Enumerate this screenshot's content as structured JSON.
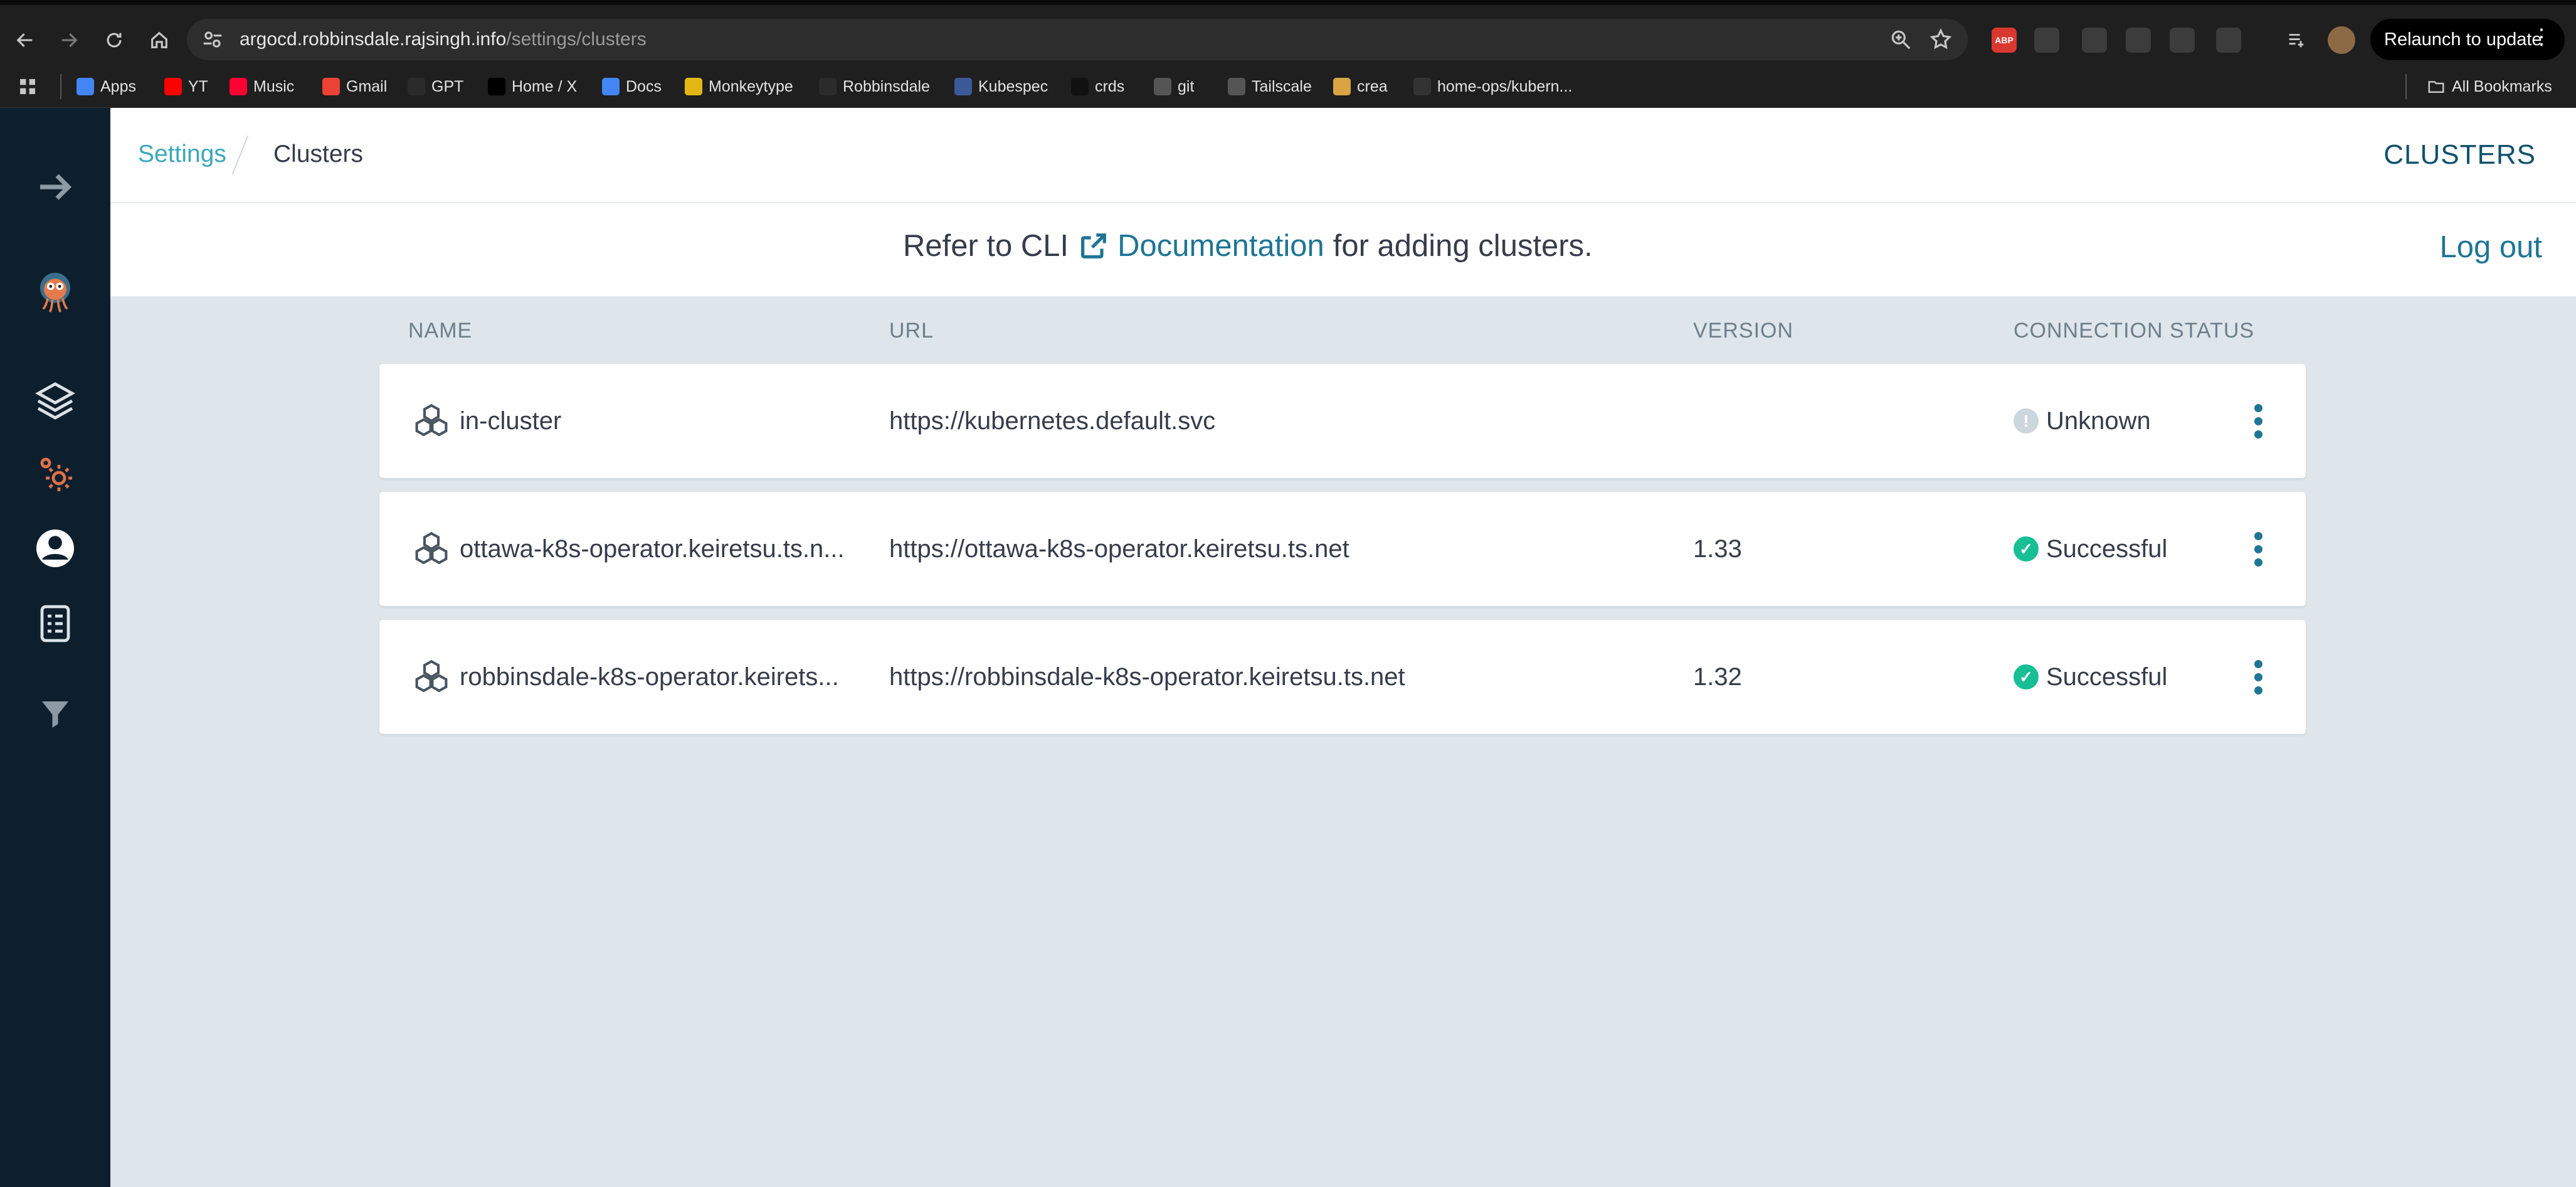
{
  "browser": {
    "url_host": "argocd.robbinsdale.rajsingh.info",
    "url_path": "/settings/clusters",
    "relaunch_label": "Relaunch to update",
    "extensions": [
      {
        "icon": "adblock-icon",
        "text": "ABP",
        "color": "#d9382f"
      },
      {
        "icon": "translate-extension-icon",
        "text": "",
        "color": "#3c3c3c"
      },
      {
        "icon": "screenshot-extension-icon",
        "text": "",
        "color": "#3c3c3c"
      },
      {
        "icon": "grammar-extension-icon",
        "text": "",
        "color": "#3c3c3c"
      },
      {
        "icon": "pen-extension-icon",
        "text": "",
        "color": "#3c3c3c"
      },
      {
        "icon": "puzzle-icon",
        "text": "",
        "color": "#3c3c3c"
      }
    ],
    "bookmarks": [
      {
        "label": "Apps",
        "icon": "apps-grid-icon"
      },
      {
        "label": "YT",
        "icon": "youtube-icon"
      },
      {
        "label": "Music",
        "icon": "youtube-music-icon"
      },
      {
        "label": "Gmail",
        "icon": "gmail-icon"
      },
      {
        "label": "GPT",
        "icon": "openai-icon"
      },
      {
        "label": "Home / X",
        "icon": "x-icon"
      },
      {
        "label": "Docs",
        "icon": "docs-icon"
      },
      {
        "label": "Monkeytype",
        "icon": "monkeytype-icon"
      },
      {
        "label": "Robbinsdale",
        "icon": "globe-icon"
      },
      {
        "label": "Kubespec",
        "icon": "kubespec-icon"
      },
      {
        "label": "crds",
        "icon": "crds-icon"
      },
      {
        "label": "git",
        "icon": "folder-icon"
      },
      {
        "label": "Tailscale",
        "icon": "tailscale-icon"
      },
      {
        "label": "crea",
        "icon": "box-icon"
      },
      {
        "label": "home-ops/kubern...",
        "icon": "github-icon"
      }
    ],
    "all_bookmarks_label": "All Bookmarks"
  },
  "header": {
    "breadcrumb_root": "Settings",
    "breadcrumb_current": "Clusters",
    "title": "CLUSTERS"
  },
  "toolbar": {
    "notice_prefix": "Refer to CLI",
    "doc_link": "Documentation",
    "notice_suffix": "for adding clusters.",
    "logout": "Log out"
  },
  "table": {
    "columns": [
      "NAME",
      "URL",
      "VERSION",
      "CONNECTION STATUS"
    ],
    "rows": [
      {
        "name": "in-cluster",
        "url": "https://kubernetes.default.svc",
        "version": "",
        "status": "Unknown",
        "status_color": "#ccd6dd"
      },
      {
        "name": "ottawa-k8s-operator.keiretsu.ts.n...",
        "url": "https://ottawa-k8s-operator.keiretsu.ts.net",
        "version": "1.33",
        "status": "Successful",
        "status_color": "#18be94"
      },
      {
        "name": "robbinsdale-k8s-operator.keirets...",
        "url": "https://robbinsdale-k8s-operator.keiretsu.ts.net",
        "version": "1.32",
        "status": "Successful",
        "status_color": "#18be94"
      }
    ]
  },
  "colors": {
    "sidebar": "#0d1f2d",
    "accent": "#1e7595",
    "breadcrumb_link": "#3ba7bc",
    "success": "#18be94",
    "unknown": "#ccd6dd",
    "background": "#dee6eb"
  }
}
